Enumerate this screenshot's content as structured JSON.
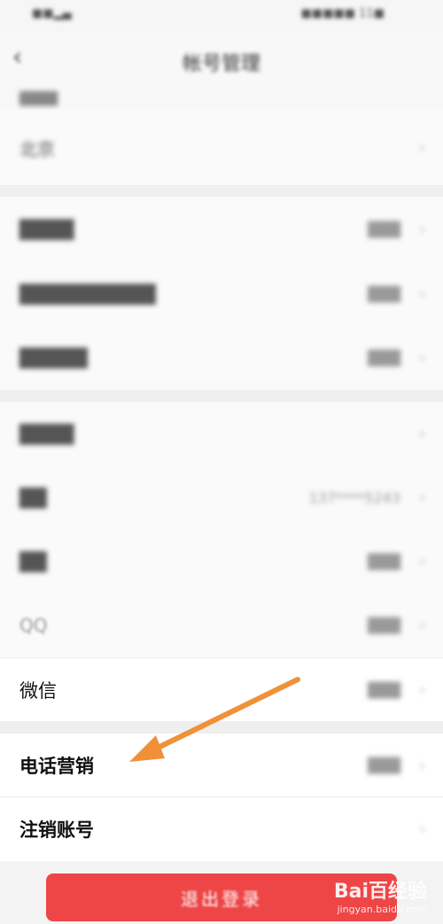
{
  "status_bar": {
    "left": "■■▂▄",
    "right": "■■■■■ 11■"
  },
  "header": {
    "title": "帐号管理"
  },
  "rows_blurred": [
    {
      "label": "北京",
      "value": ""
    },
    {
      "label": "████",
      "value": "███"
    },
    {
      "label": "██████████",
      "value": "███"
    },
    {
      "label": "█████",
      "value": "███"
    },
    {
      "label": "████",
      "value": ""
    },
    {
      "label": "██",
      "value": "137****5243"
    },
    {
      "label": "██",
      "value": "███"
    },
    {
      "label": "QQ",
      "value": "███"
    }
  ],
  "rows_sharp": [
    {
      "label": "微信",
      "value": "███"
    },
    {
      "label": "电话营销",
      "value": "███"
    },
    {
      "label": "注销账号",
      "value": ""
    }
  ],
  "logout_button": "退出登录",
  "watermark": {
    "main": "Bai百经验",
    "sub": "jingyan.baidu.com"
  },
  "colors": {
    "logout_bg": "#ee4546",
    "arrow": "#f0913a"
  }
}
